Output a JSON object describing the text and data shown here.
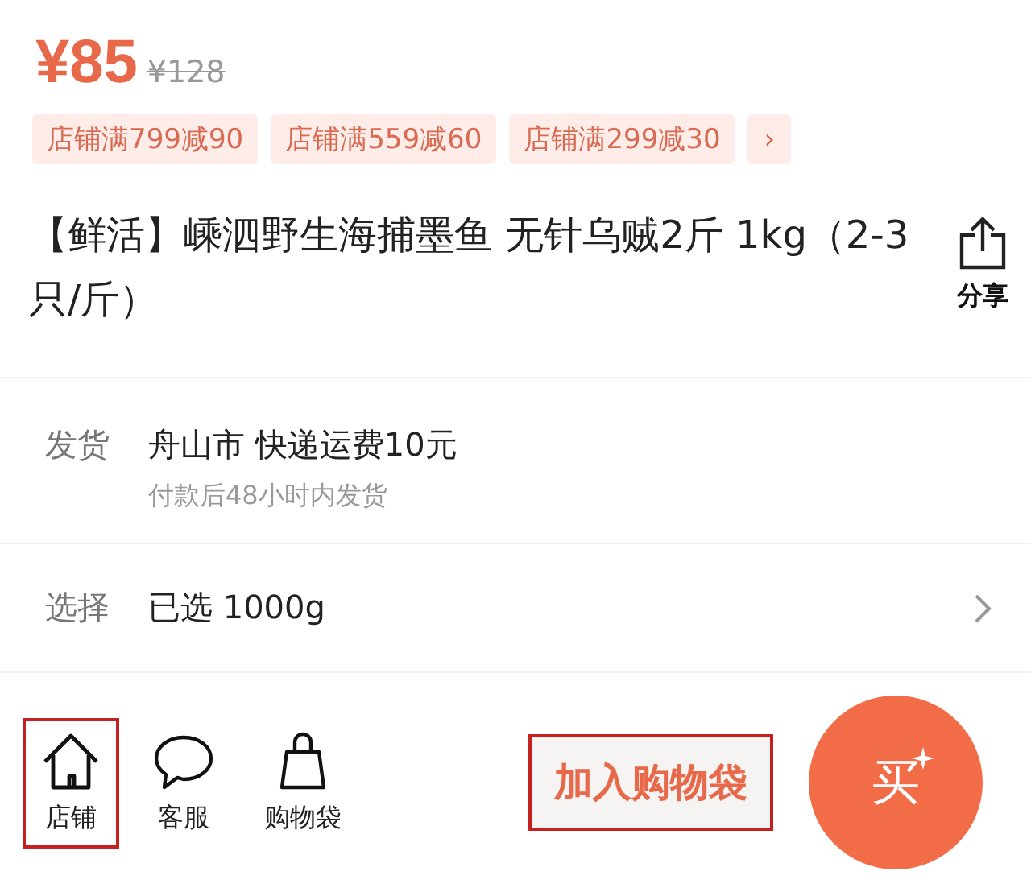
{
  "price": {
    "current": "¥85",
    "original": "¥128"
  },
  "coupons": [
    "店铺满799减90",
    "店铺满559减60",
    "店铺满299减30"
  ],
  "coupons_more": "›",
  "title": "【鲜活】嵊泗野生海捕墨鱼 无针乌贼2斤 1kg（2-3只/斤）",
  "share": {
    "label": "分享"
  },
  "shipping": {
    "label": "发货",
    "value": "舟山市 快递运费10元",
    "note": "付款后48小时内发货"
  },
  "spec": {
    "label": "选择",
    "value": "已选 1000g"
  },
  "nav": [
    {
      "kind": "store",
      "label": "店铺",
      "highlighted": true
    },
    {
      "kind": "chat",
      "label": "客服",
      "highlighted": false
    },
    {
      "kind": "bag",
      "label": "购物袋",
      "highlighted": false
    }
  ],
  "add_to_bag": {
    "label": "加入购物袋",
    "highlighted": true
  },
  "buy": {
    "label": "买"
  }
}
